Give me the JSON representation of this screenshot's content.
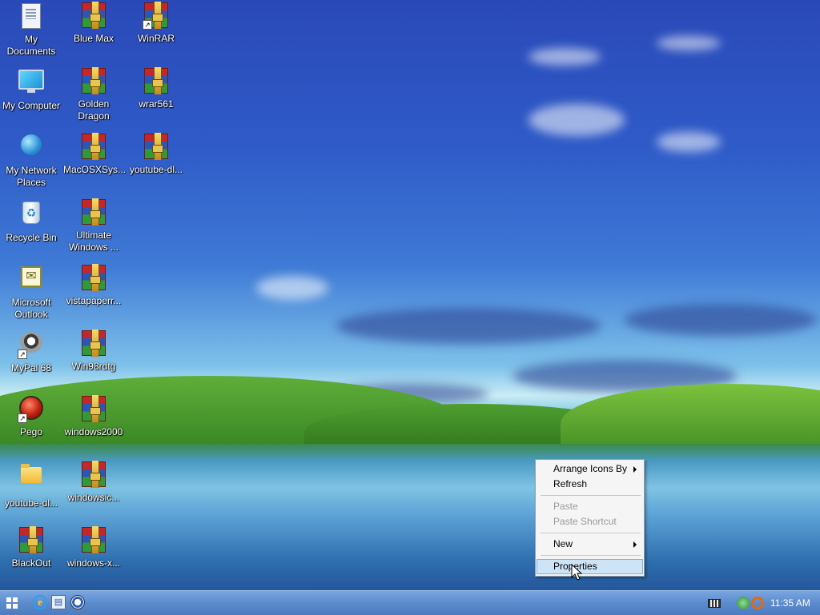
{
  "desktop": {
    "icons": [
      {
        "label": "My Documents",
        "icon": "document-icon"
      },
      {
        "label": "My Computer",
        "icon": "monitor-icon"
      },
      {
        "label": "My Network Places",
        "icon": "globe-icon"
      },
      {
        "label": "Recycle Bin",
        "icon": "recycle-bin-icon"
      },
      {
        "label": "Microsoft Outlook",
        "icon": "outlook-icon"
      },
      {
        "label": "MyPal 68",
        "icon": "raccoon-icon"
      },
      {
        "label": "Pego",
        "icon": "red-orb-icon"
      },
      {
        "label": "youtube-dl...",
        "icon": "folder-icon"
      },
      {
        "label": "BlackOut",
        "icon": "rar-archive-icon"
      },
      {
        "label": "Blue Max",
        "icon": "rar-archive-icon"
      },
      {
        "label": "Golden Dragon",
        "icon": "rar-archive-icon"
      },
      {
        "label": "MacOSXSys...",
        "icon": "rar-archive-icon"
      },
      {
        "label": "Ultimate Windows ...",
        "icon": "rar-archive-icon"
      },
      {
        "label": "vistapaperr...",
        "icon": "rar-archive-icon"
      },
      {
        "label": "Win98rdtg",
        "icon": "rar-archive-icon"
      },
      {
        "label": "windows2000",
        "icon": "rar-archive-icon"
      },
      {
        "label": "windowsic...",
        "icon": "rar-archive-icon"
      },
      {
        "label": "windows-x...",
        "icon": "rar-archive-icon"
      },
      {
        "label": "WinRAR",
        "icon": "rar-archive-icon"
      },
      {
        "label": "wrar561",
        "icon": "rar-archive-icon"
      },
      {
        "label": "youtube-dl...",
        "icon": "rar-archive-icon"
      }
    ]
  },
  "context_menu": {
    "items": [
      {
        "label": "Arrange Icons By",
        "submenu": true,
        "state": "enabled"
      },
      {
        "label": "Refresh",
        "state": "enabled"
      },
      {
        "label": "Paste",
        "state": "disabled"
      },
      {
        "label": "Paste Shortcut",
        "state": "disabled"
      },
      {
        "label": "New",
        "submenu": true,
        "state": "enabled"
      },
      {
        "label": "Properties",
        "state": "highlighted"
      }
    ]
  },
  "taskbar": {
    "start_icon": "windows-logo-icon",
    "quick_launch": [
      "internet-explorer-icon",
      "explorer-icon",
      "media-player-icon"
    ],
    "tray": [
      "keyboard-icon",
      "network-icon",
      "search-icon"
    ],
    "clock": "11:35 AM"
  },
  "colors": {
    "taskbar": "#5c8bcd",
    "menu_highlight": "#cde4f7",
    "disabled_text": "#9a9a9a"
  }
}
